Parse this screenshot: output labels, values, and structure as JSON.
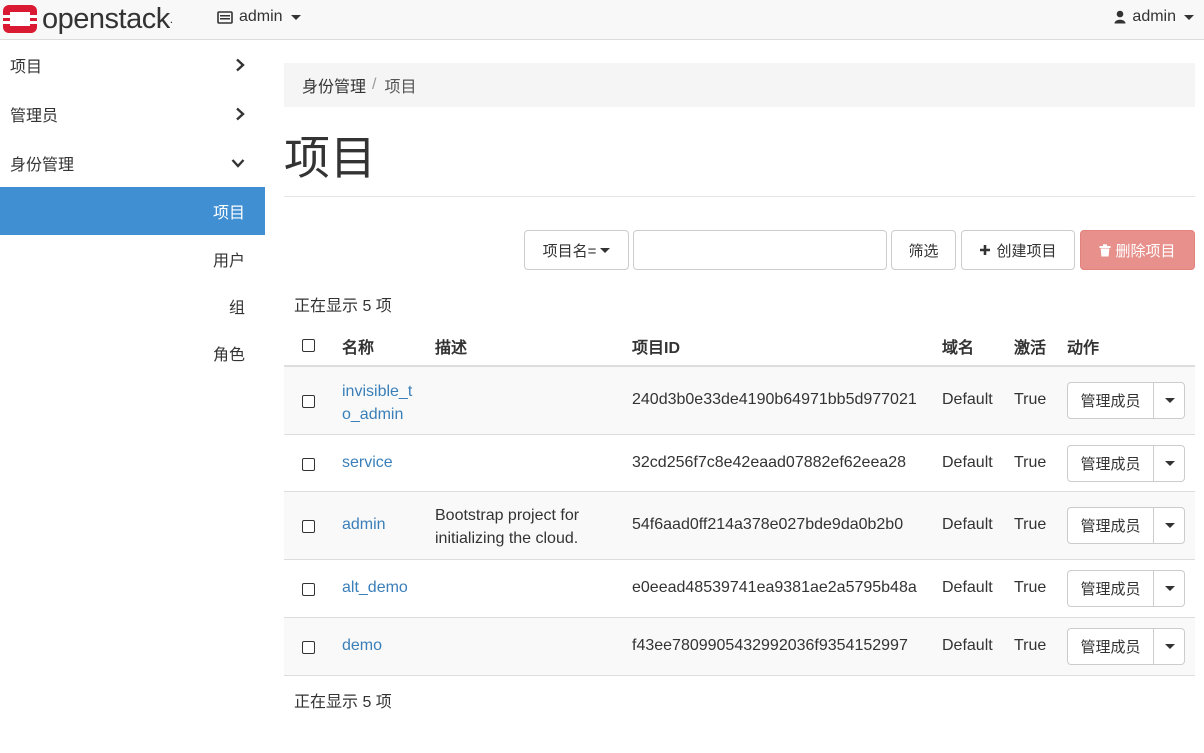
{
  "brand": {
    "name": "openstack",
    "suffix": "."
  },
  "navbar": {
    "project_selector": "admin",
    "user_menu": "admin"
  },
  "sidebar": {
    "items": [
      {
        "label": "项目",
        "state": "collapsed"
      },
      {
        "label": "管理员",
        "state": "collapsed"
      },
      {
        "label": "身份管理",
        "state": "expanded"
      }
    ],
    "sub_items": [
      {
        "label": "项目",
        "active": true
      },
      {
        "label": "用户",
        "active": false
      },
      {
        "label": "组",
        "active": false
      },
      {
        "label": "角色",
        "active": false
      }
    ]
  },
  "breadcrumb": {
    "parent": "身份管理",
    "separator": "/",
    "current": "项目"
  },
  "page_title": "项目",
  "toolbar": {
    "filter_field": "项目名=",
    "filter_value": "",
    "filter_button": "筛选",
    "create_button": "创建项目",
    "delete_button": "删除项目"
  },
  "count_top": "正在显示 5 项",
  "count_bottom": "正在显示 5 项",
  "table": {
    "headers": {
      "name": "名称",
      "description": "描述",
      "project_id": "项目ID",
      "domain": "域名",
      "enabled": "激活",
      "actions": "动作"
    },
    "rows": [
      {
        "name_line1": "invisible_t",
        "name_line2": "o_admin",
        "description_line1": "",
        "description_line2": "",
        "project_id": "240d3b0e33de4190b64971bb5d977021",
        "domain": "Default",
        "enabled": "True",
        "action": "管理成员"
      },
      {
        "name_line1": "service",
        "name_line2": "",
        "description_line1": "",
        "description_line2": "",
        "project_id": "32cd256f7c8e42eaad07882ef62eea28",
        "domain": "Default",
        "enabled": "True",
        "action": "管理成员"
      },
      {
        "name_line1": "admin",
        "name_line2": "",
        "description_line1": "Bootstrap project for",
        "description_line2": "initializing the cloud.",
        "project_id": "54f6aad0ff214a378e027bde9da0b2b0",
        "domain": "Default",
        "enabled": "True",
        "action": "管理成员"
      },
      {
        "name_line1": "alt_demo",
        "name_line2": "",
        "description_line1": "",
        "description_line2": "",
        "project_id": "e0eead48539741ea9381ae2a5795b48a",
        "domain": "Default",
        "enabled": "True",
        "action": "管理成员"
      },
      {
        "name_line1": "demo",
        "name_line2": "",
        "description_line1": "",
        "description_line2": "",
        "project_id": "f43ee7809905432992036f9354152997",
        "domain": "Default",
        "enabled": "True",
        "action": "管理成员"
      }
    ]
  },
  "colors": {
    "accent": "#3f8fd2",
    "link": "#3a7fb9",
    "danger": "#e7908c",
    "brand_red": "#da1a32"
  },
  "icons": [
    "openstack-logo-icon",
    "monitor-icon",
    "user-icon",
    "chevron-right-icon",
    "chevron-down-icon",
    "plus-icon",
    "trash-icon",
    "caret-down-icon"
  ]
}
